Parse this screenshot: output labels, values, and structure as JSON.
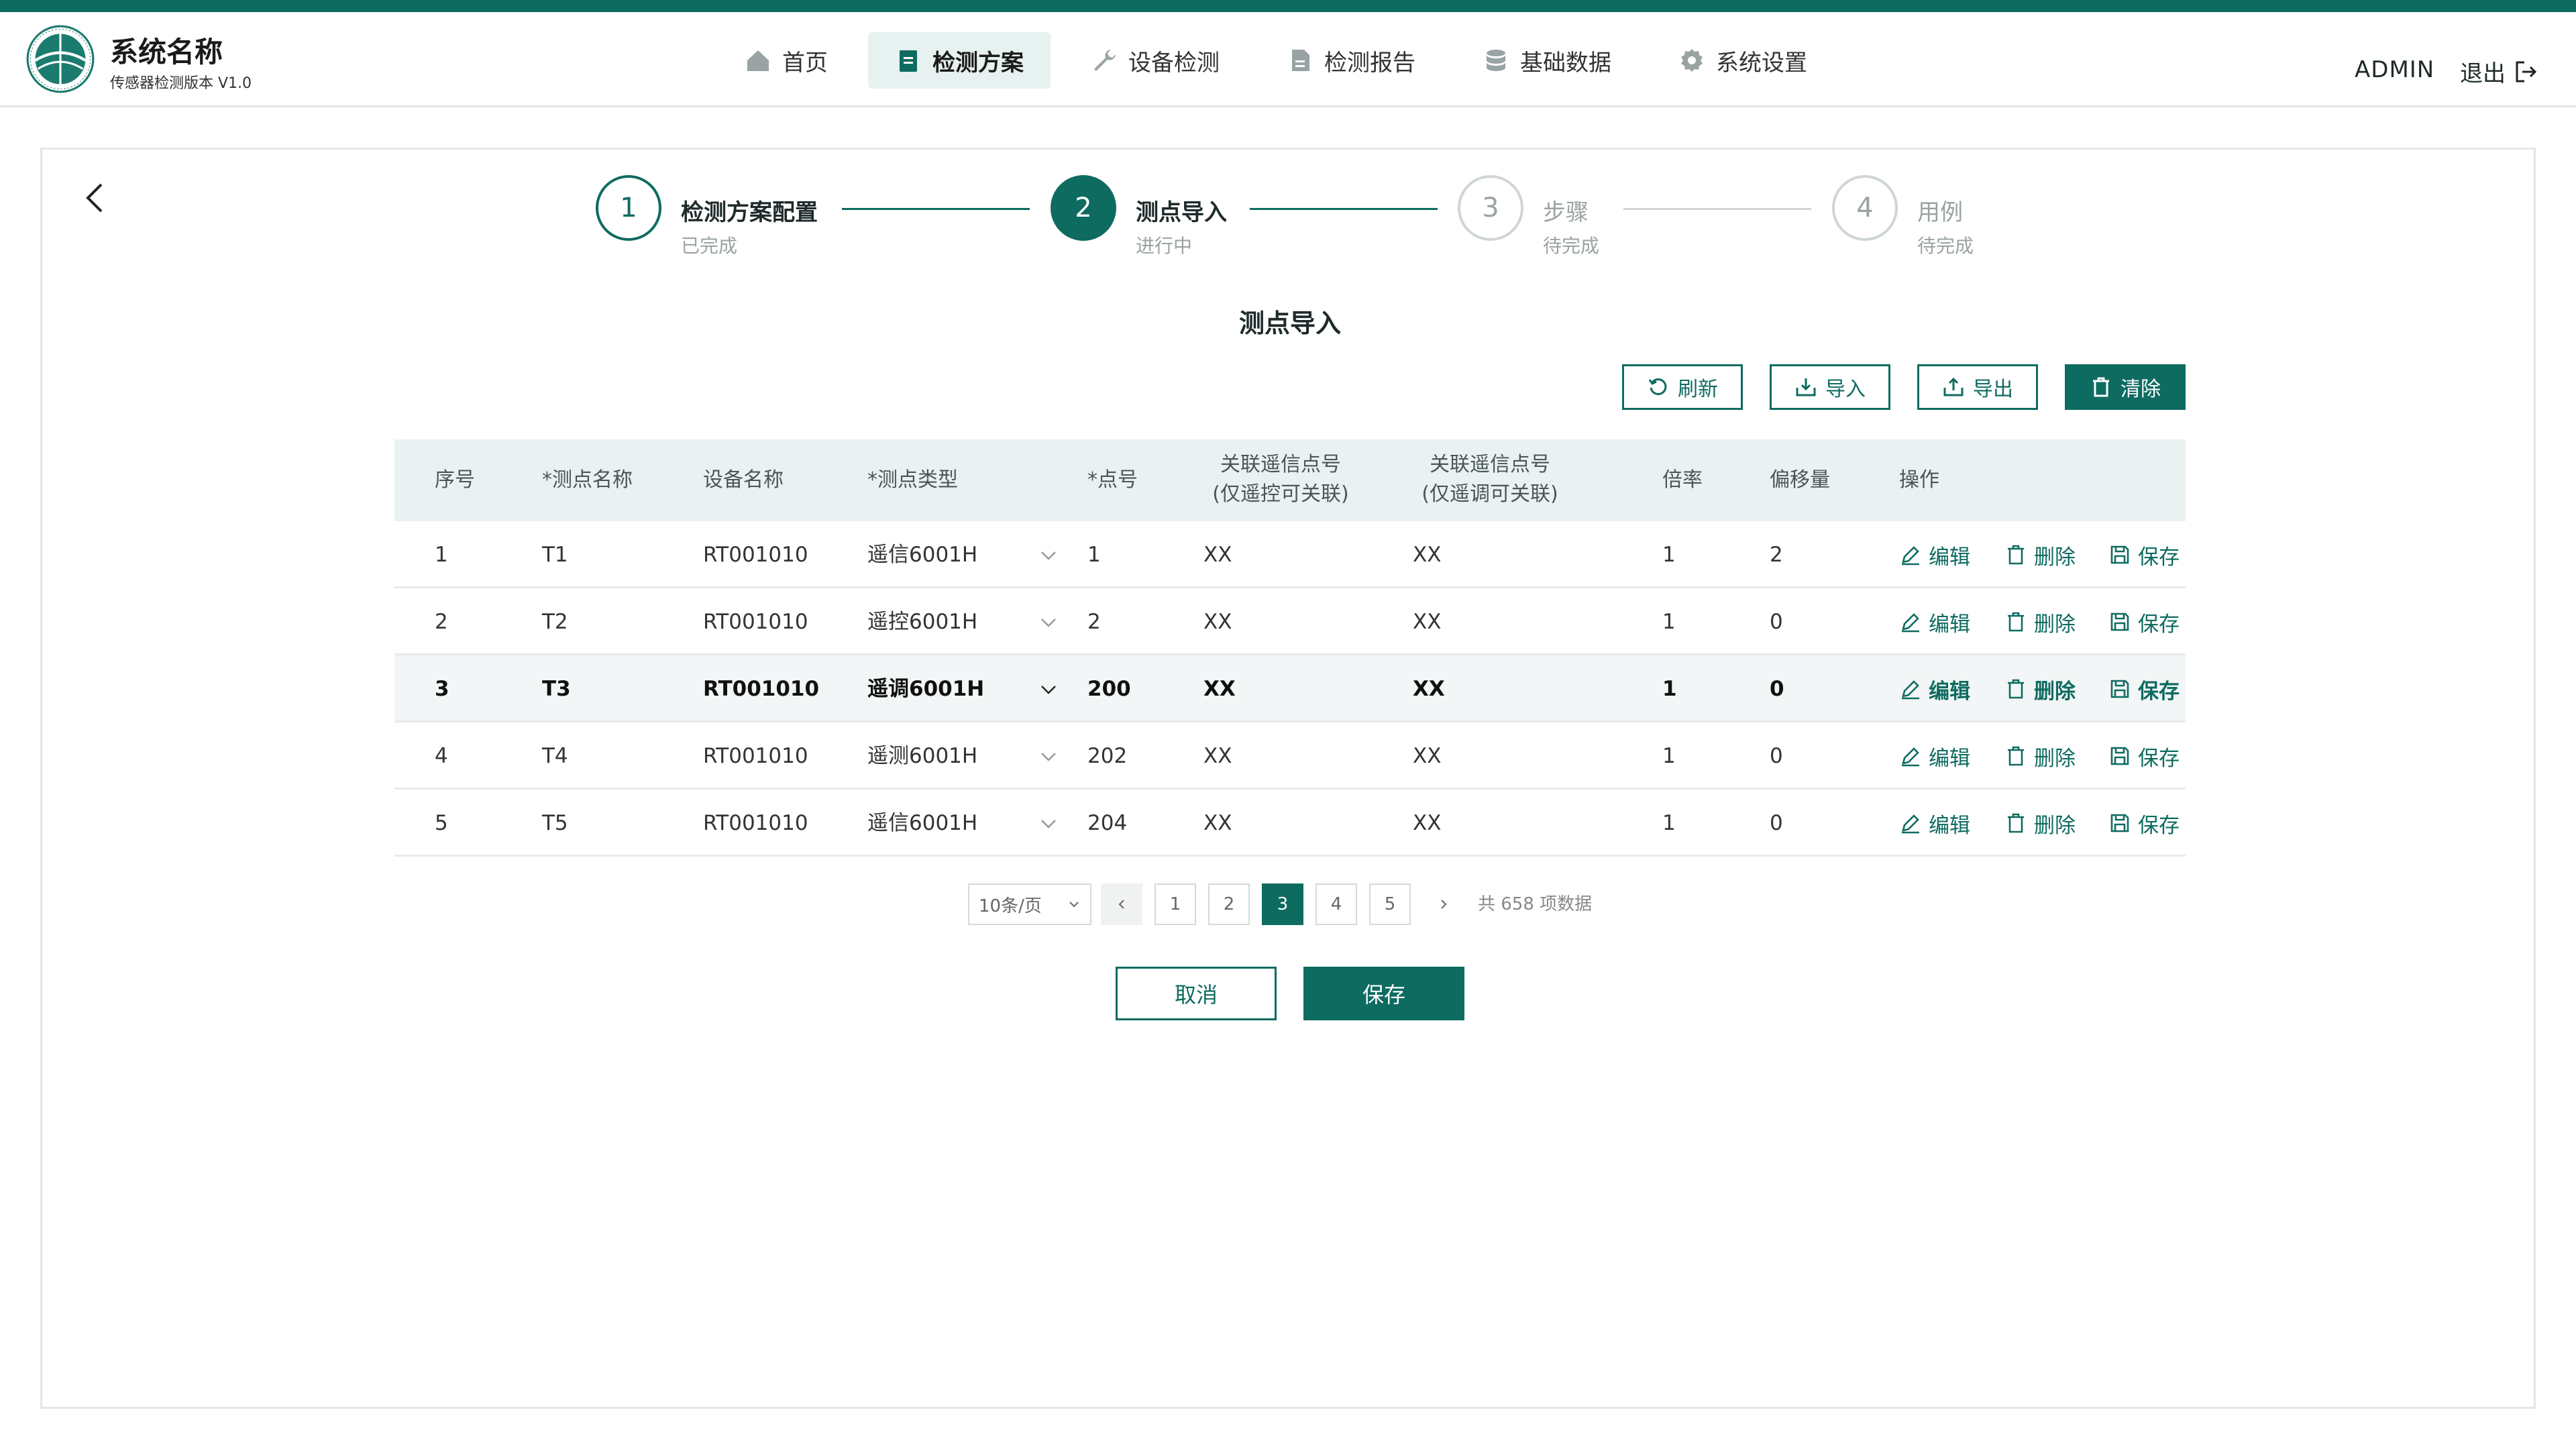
{
  "app": {
    "title": "系统名称",
    "version": "传感器检测版本 V1.0"
  },
  "nav": [
    {
      "label": "首页",
      "icon": "home-icon"
    },
    {
      "label": "检测方案",
      "icon": "clipboard-icon",
      "active": true
    },
    {
      "label": "设备检测",
      "icon": "wrench-icon"
    },
    {
      "label": "检测报告",
      "icon": "report-icon"
    },
    {
      "label": "基础数据",
      "icon": "database-icon"
    },
    {
      "label": "系统设置",
      "icon": "gear-icon"
    }
  ],
  "user": {
    "name": "ADMIN",
    "logout": "退出"
  },
  "steps": [
    {
      "num": "1",
      "title": "检测方案配置",
      "status": "已完成"
    },
    {
      "num": "2",
      "title": "测点导入",
      "status": "进行中"
    },
    {
      "num": "3",
      "title": "步骤",
      "status": "待完成"
    },
    {
      "num": "4",
      "title": "用例",
      "status": "待完成"
    }
  ],
  "page_title": "测点导入",
  "toolbar": {
    "refresh": "刷新",
    "import": "导入",
    "export": "导出",
    "clear": "清除"
  },
  "table": {
    "headers": [
      "序号",
      "*测点名称",
      "设备名称",
      "*测点类型",
      "*点号",
      "关联遥信点号",
      "(仅遥控可关联)",
      "关联遥信点号",
      "(仅遥调可关联)",
      "倍率",
      "偏移量",
      "操作"
    ],
    "actions": {
      "edit": "编辑",
      "delete": "删除",
      "save": "保存"
    },
    "rows": [
      {
        "idx": "1",
        "name": "T1",
        "device": "RT001010",
        "type": "遥信6001H",
        "point": "1",
        "ctrl": "XX",
        "adj": "XX",
        "rate": "1",
        "offset": "2"
      },
      {
        "idx": "2",
        "name": "T2",
        "device": "RT001010",
        "type": "遥控6001H",
        "point": "2",
        "ctrl": "XX",
        "adj": "XX",
        "rate": "1",
        "offset": "0"
      },
      {
        "idx": "3",
        "name": "T3",
        "device": "RT001010",
        "type": "遥调6001H",
        "point": "200",
        "ctrl": "XX",
        "adj": "XX",
        "rate": "1",
        "offset": "0"
      },
      {
        "idx": "4",
        "name": "T4",
        "device": "RT001010",
        "type": "遥测6001H",
        "point": "202",
        "ctrl": "XX",
        "adj": "XX",
        "rate": "1",
        "offset": "0"
      },
      {
        "idx": "5",
        "name": "T5",
        "device": "RT001010",
        "type": "遥信6001H",
        "point": "204",
        "ctrl": "XX",
        "adj": "XX",
        "rate": "1",
        "offset": "0"
      }
    ]
  },
  "pagination": {
    "page_size": "10条/页",
    "pages": [
      "1",
      "2",
      "3",
      "4",
      "5"
    ],
    "current": "3",
    "total": "共 658 项数据"
  },
  "footer": {
    "cancel": "取消",
    "save": "保存"
  },
  "colors": {
    "primary": "#0e6b60",
    "header_bg": "#e9f2f1"
  }
}
